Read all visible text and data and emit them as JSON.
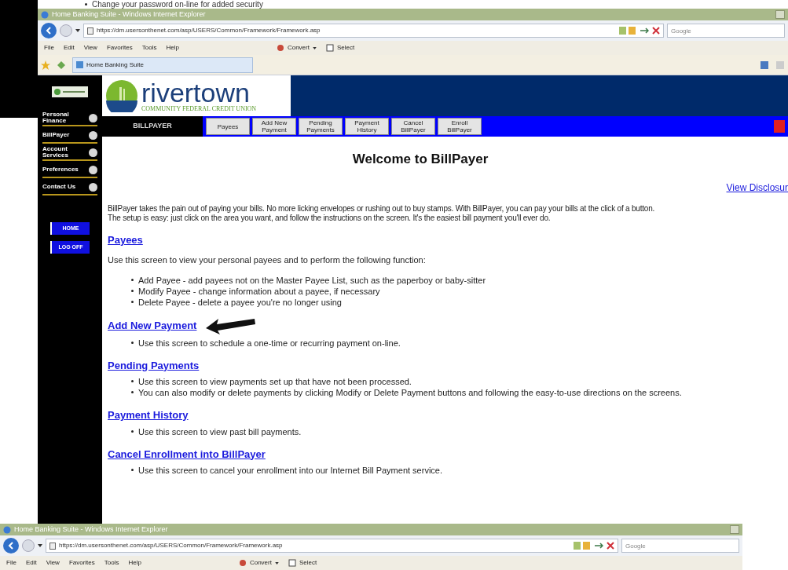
{
  "background_text": "Change your password on-line for added security",
  "browser": {
    "title": "Home Banking Suite - Windows Internet Explorer",
    "url": "https://dm.usersonthenet.com/asp/USERS/Common/Framework/Framework.asp",
    "search": {
      "placeholder": "Google"
    },
    "menu": [
      "File",
      "Edit",
      "View",
      "Favorites",
      "Tools",
      "Help"
    ],
    "toolbar": [
      "Convert",
      "Select"
    ],
    "tab": "Home Banking Suite"
  },
  "logo": {
    "name": "rivertown",
    "tagline": "COMMUNITY FEDERAL CREDIT UNION"
  },
  "sidebar": {
    "items": [
      "Personal Finance",
      "BillPayer",
      "Account Services",
      "Preferences",
      "Contact Us"
    ],
    "buttons": [
      "HOME",
      "LOG OFF"
    ]
  },
  "section_label": "BILLPAYER",
  "nav_tabs": [
    "Payees",
    "Add New Payment",
    "Pending Payments",
    "Payment History",
    "Cancel BillPayer",
    "Enroll BillPayer"
  ],
  "page": {
    "title": "Welcome to BillPayer",
    "disclosure_link": "View Disclosur",
    "intro": [
      "BillPayer takes the pain out of paying your bills.  No more licking envelopes or rushing out to buy stamps. With BillPayer, you can pay your bills at the click of a button.",
      "The setup is easy: just click on the area you want, and follow the instructions on the screen. It's the easiest bill payment you'll ever do."
    ],
    "sections": [
      {
        "heading": "Payees",
        "text": "Use this screen to view your personal payees and to perform the following function:",
        "bullets": [
          "Add Payee - add payees not on the Master Payee List, such as the paperboy or baby-sitter",
          "Modify Payee - change information about a payee, if necessary",
          "Delete Payee - delete a payee you're no longer using"
        ],
        "pointer": false
      },
      {
        "heading": "Add New Payment",
        "bullets": [
          "Use this screen to schedule a one-time or recurring payment on-line."
        ],
        "pointer": true
      },
      {
        "heading": "Pending Payments",
        "bullets": [
          "Use this screen to view payments set up that have not been processed.",
          "You can also modify or delete payments by clicking Modify or Delete Payment buttons and following the easy-to-use directions on the screens."
        ],
        "pointer": false
      },
      {
        "heading": "Payment History",
        "bullets": [
          "Use this screen to view past bill payments."
        ],
        "pointer": false
      },
      {
        "heading": "Cancel Enrollment into BillPayer",
        "bullets": [
          "Use this screen to cancel your enrollment into our Internet Bill Payment service."
        ],
        "pointer": false
      }
    ]
  },
  "second_browser": {
    "title": "Home Banking Suite - Windows Internet Explorer",
    "url": "https://dm.usersonthenet.com/asp/USERS/Common/Framework/Framework.asp",
    "search": {
      "placeholder": "Google"
    },
    "menu": [
      "File",
      "Edit",
      "View",
      "Favorites",
      "Tools",
      "Help"
    ],
    "toolbar": [
      "Convert",
      "Select"
    ]
  }
}
